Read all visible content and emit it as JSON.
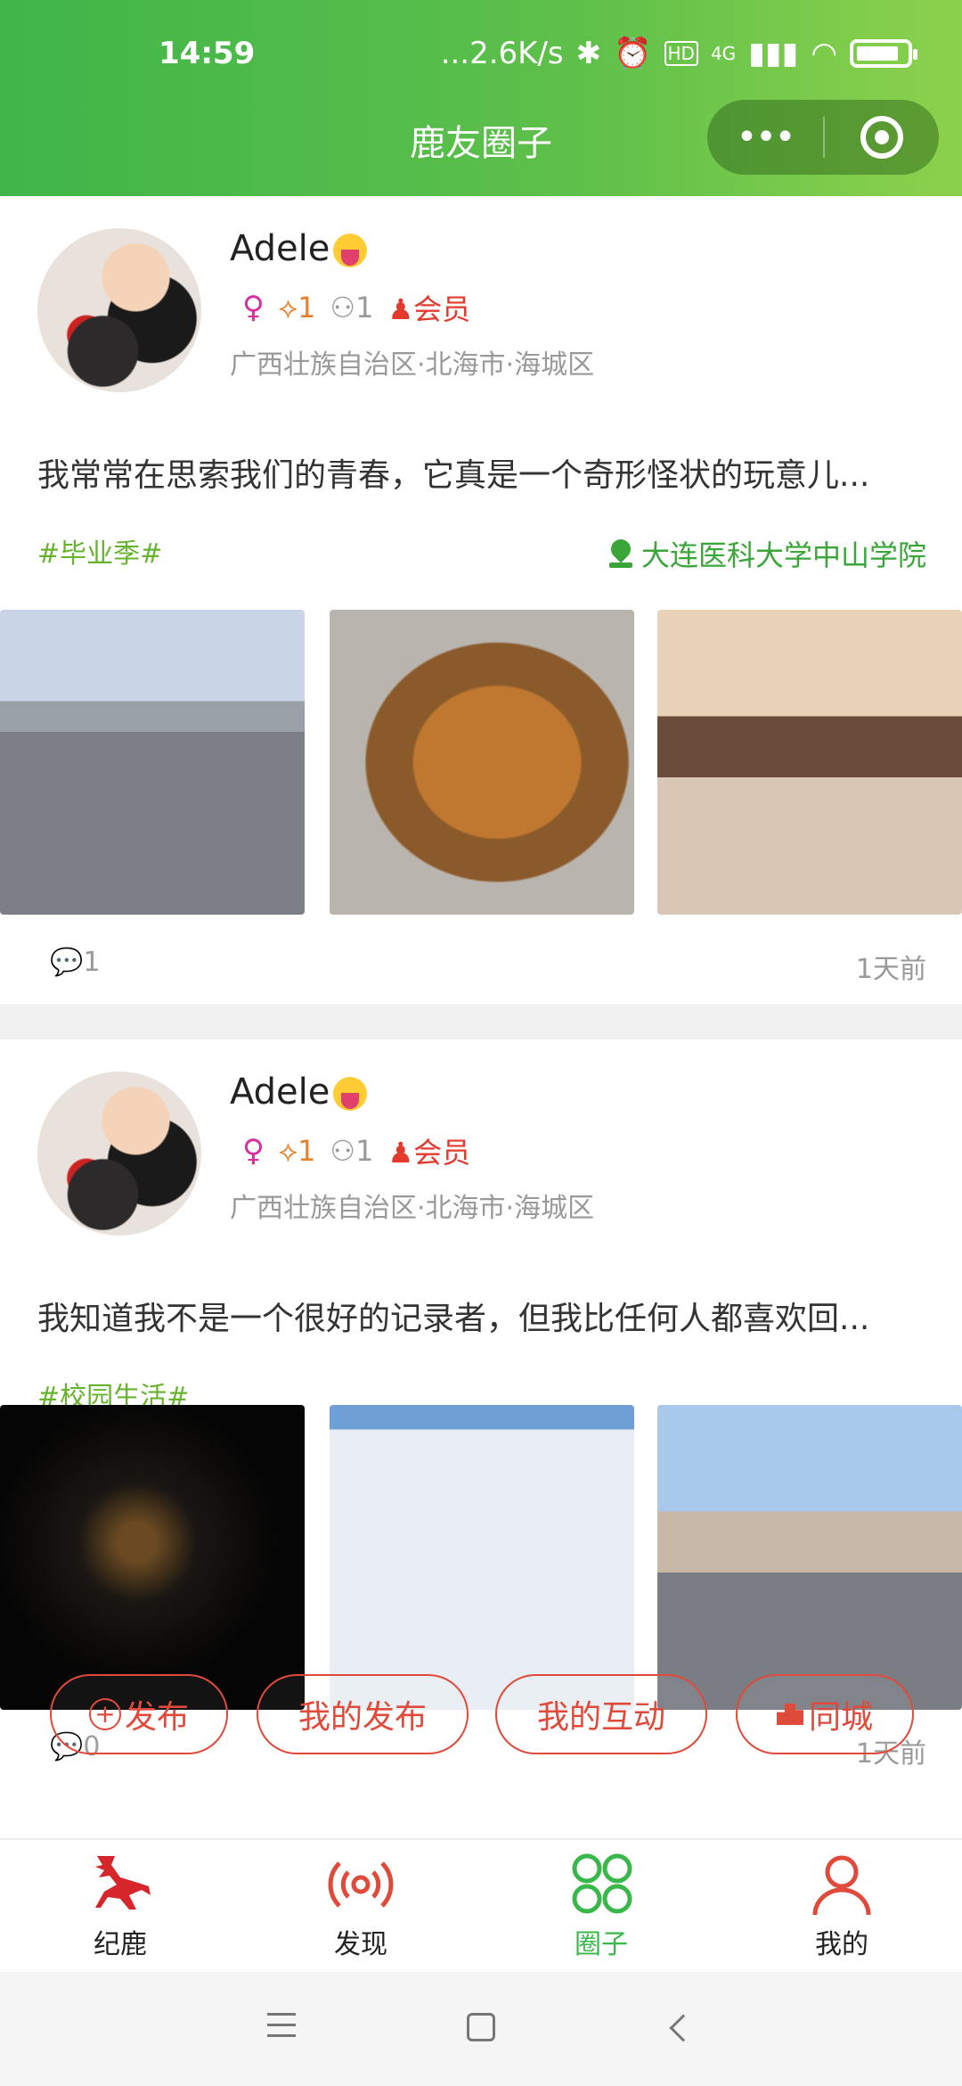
{
  "status_bar": {
    "time": "14:59",
    "net_speed": "...2.6K/s",
    "hd": "HD",
    "signal_label": "4G"
  },
  "header": {
    "title": "鹿友圈子",
    "menu_label": "•••"
  },
  "posts": [
    {
      "user": "Adele",
      "gender_symbol": "♀",
      "deer_count": "1",
      "fans_count": "1",
      "vip_label": "会员",
      "location": "广西壮族自治区·北海市·海城区",
      "content": "我常常在思索我们的青春，它真是一个奇形怪状的玩意儿...",
      "tag": "#毕业季#",
      "place": "大连医科大学中山学院",
      "comments": "1",
      "time_ago": "1天前"
    },
    {
      "user": "Adele",
      "gender_symbol": "♀",
      "deer_count": "1",
      "fans_count": "1",
      "vip_label": "会员",
      "location": "广西壮族自治区·北海市·海城区",
      "content": "我知道我不是一个很好的记录者，但我比任何人都喜欢回...",
      "tag": "#校园生活#",
      "comments": "0",
      "time_ago": "1天前"
    }
  ],
  "floating_actions": {
    "publish": "发布",
    "my_posts": "我的发布",
    "my_interactions": "我的互动",
    "same_city": "同城"
  },
  "tabs": [
    {
      "label": "纪鹿",
      "icon": "deer-icon"
    },
    {
      "label": "发现",
      "icon": "broadcast-icon"
    },
    {
      "label": "圈子",
      "icon": "circles-icon",
      "active": true
    },
    {
      "label": "我的",
      "icon": "user-icon"
    }
  ],
  "colors": {
    "brand_green": "#3fb549",
    "accent_red": "#e04a3a",
    "tag_green": "#67b32d"
  }
}
